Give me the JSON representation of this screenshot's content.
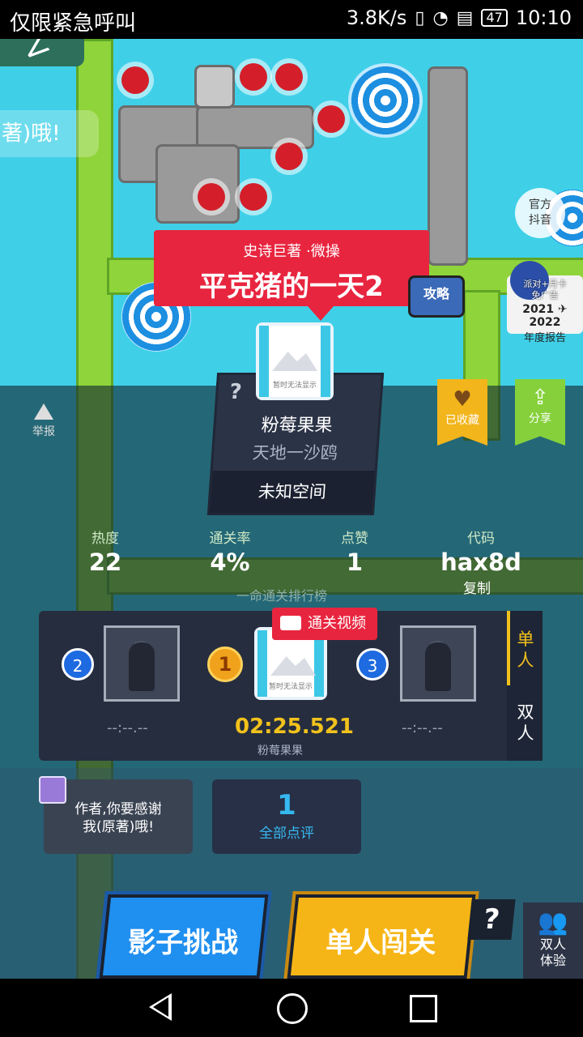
{
  "status_bar": {
    "carrier": "仅限紧急呼叫",
    "speed": "3.8K/s",
    "battery": "47",
    "time": "10:10"
  },
  "side_chat": "著)哦!",
  "banner": {
    "subtitle": "史诗巨著 ·微操",
    "title": "平克猪的一天2"
  },
  "official_douyin": "官方\n抖音",
  "strategy": "攻略",
  "report_card": {
    "top": "派对+月卡",
    "mid": "免广告",
    "years": "2021 ✈ 2022",
    "label": "年度报告"
  },
  "report_label": "举报",
  "collected_label": "已收藏",
  "share_label": "分享",
  "author": {
    "name": "粉莓果果",
    "subtitle": "天地一沙鸥",
    "space": "未知空间",
    "avatar_caption": "暂时无法显示"
  },
  "stats": [
    {
      "label": "热度",
      "value": "22"
    },
    {
      "label": "通关率",
      "value": "4%"
    },
    {
      "label": "点赞",
      "value": "1"
    },
    {
      "label": "代码",
      "value": "hax8d"
    }
  ],
  "copy_label": "复制",
  "leaderboard_title": "一命通关排行榜",
  "leaderboard": {
    "tabs": [
      "单人",
      "双人"
    ],
    "video_label": "通关视频",
    "entries": [
      {
        "rank": "2",
        "time": "--:--.--",
        "name": ""
      },
      {
        "rank": "1",
        "time": "02:25.521",
        "name": "粉莓果果"
      },
      {
        "rank": "3",
        "time": "--:--.--",
        "name": ""
      }
    ]
  },
  "comment_thanks": "作者,你要感谢\n我(原著)哦!",
  "all_reviews": {
    "count": "1",
    "label": "全部点评"
  },
  "buttons": {
    "shadow_challenge": "影子挑战",
    "single_play": "单人闯关",
    "help": "?",
    "duo": "双人\n体验"
  },
  "colors": {
    "banner_red": "#e8253f",
    "gold": "#f2c21c",
    "blue_button": "#1f8ff0",
    "yellow_button": "#f6b516",
    "review_blue": "#36b8f0"
  }
}
